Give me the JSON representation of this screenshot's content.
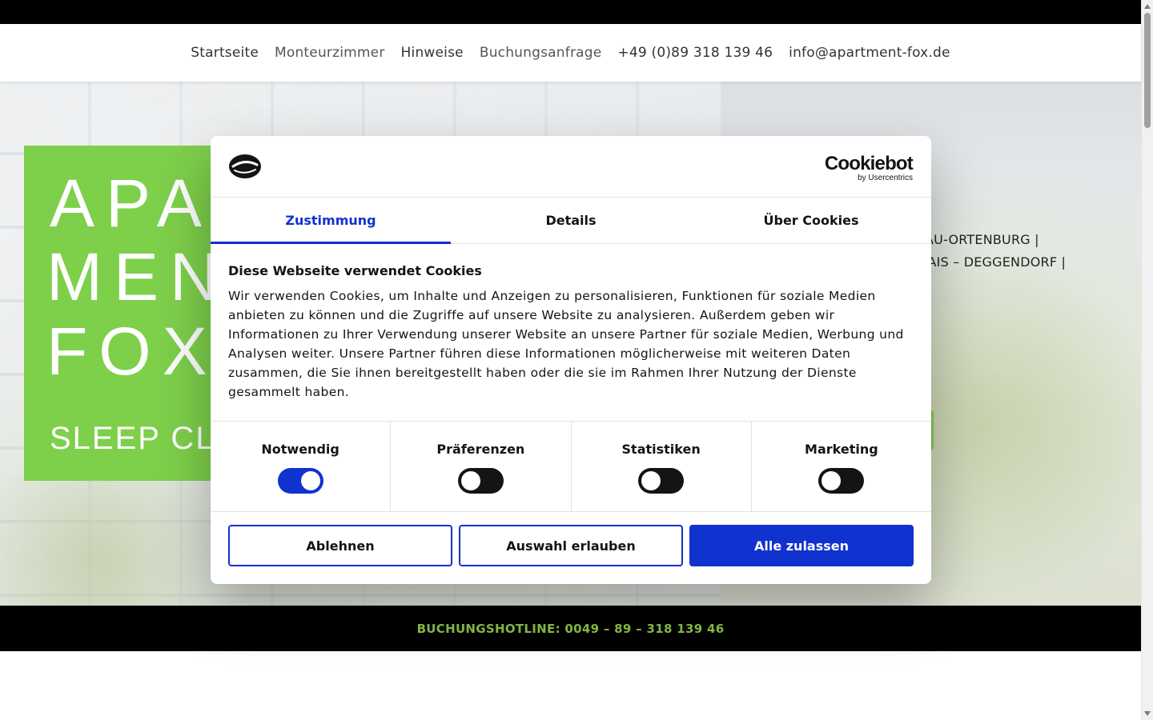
{
  "nav": {
    "items": [
      "Startseite",
      "Monteurzimmer",
      "Hinweise",
      "Buchungsanfrage",
      "+49 (0)89 318 139 46",
      "info@apartment-fox.de"
    ]
  },
  "hero": {
    "brand_line1": "APA",
    "brand_line2": "MEN",
    "brand_line3": "FOX",
    "tagline": "SLEEP CLEV",
    "location_line1": "AU-ORTENBURG |",
    "location_line2": "HOFSMAIS – DEGGENDORF |"
  },
  "hotline": {
    "text": "BUCHUNGSHOTLINE: 0049 – 89 – 318 139 46"
  },
  "cookie_dialog": {
    "brand_name": "Cookiebot",
    "brand_sub": "by Usercentrics",
    "tabs": [
      "Zustimmung",
      "Details",
      "Über Cookies"
    ],
    "active_tab": "Zustimmung",
    "title": "Diese Webseite verwendet Cookies",
    "body": "Wir verwenden Cookies, um Inhalte und Anzeigen zu personalisieren, Funktionen für soziale Medien anbieten zu können und die Zugriffe auf unsere Website zu analysieren. Außerdem geben wir Informationen zu Ihrer Verwendung unserer Website an unsere Partner für soziale Medien, Werbung und Analysen weiter. Unsere Partner führen diese Informationen möglicherweise mit weiteren Daten zusammen, die Sie ihnen bereitgestellt haben oder die sie im Rahmen Ihrer Nutzung der Dienste gesammelt haben.",
    "categories": [
      {
        "label": "Notwendig",
        "enabled": true
      },
      {
        "label": "Präferenzen",
        "enabled": false
      },
      {
        "label": "Statistiken",
        "enabled": false
      },
      {
        "label": "Marketing",
        "enabled": false
      }
    ],
    "buttons": {
      "decline": "Ablehnen",
      "allow_selection": "Auswahl erlauben",
      "allow_all": "Alle zulassen"
    }
  },
  "colors": {
    "accent_blue": "#1032cf",
    "brand_green": "#7ed04b",
    "hotline_green": "#8bc34a"
  }
}
